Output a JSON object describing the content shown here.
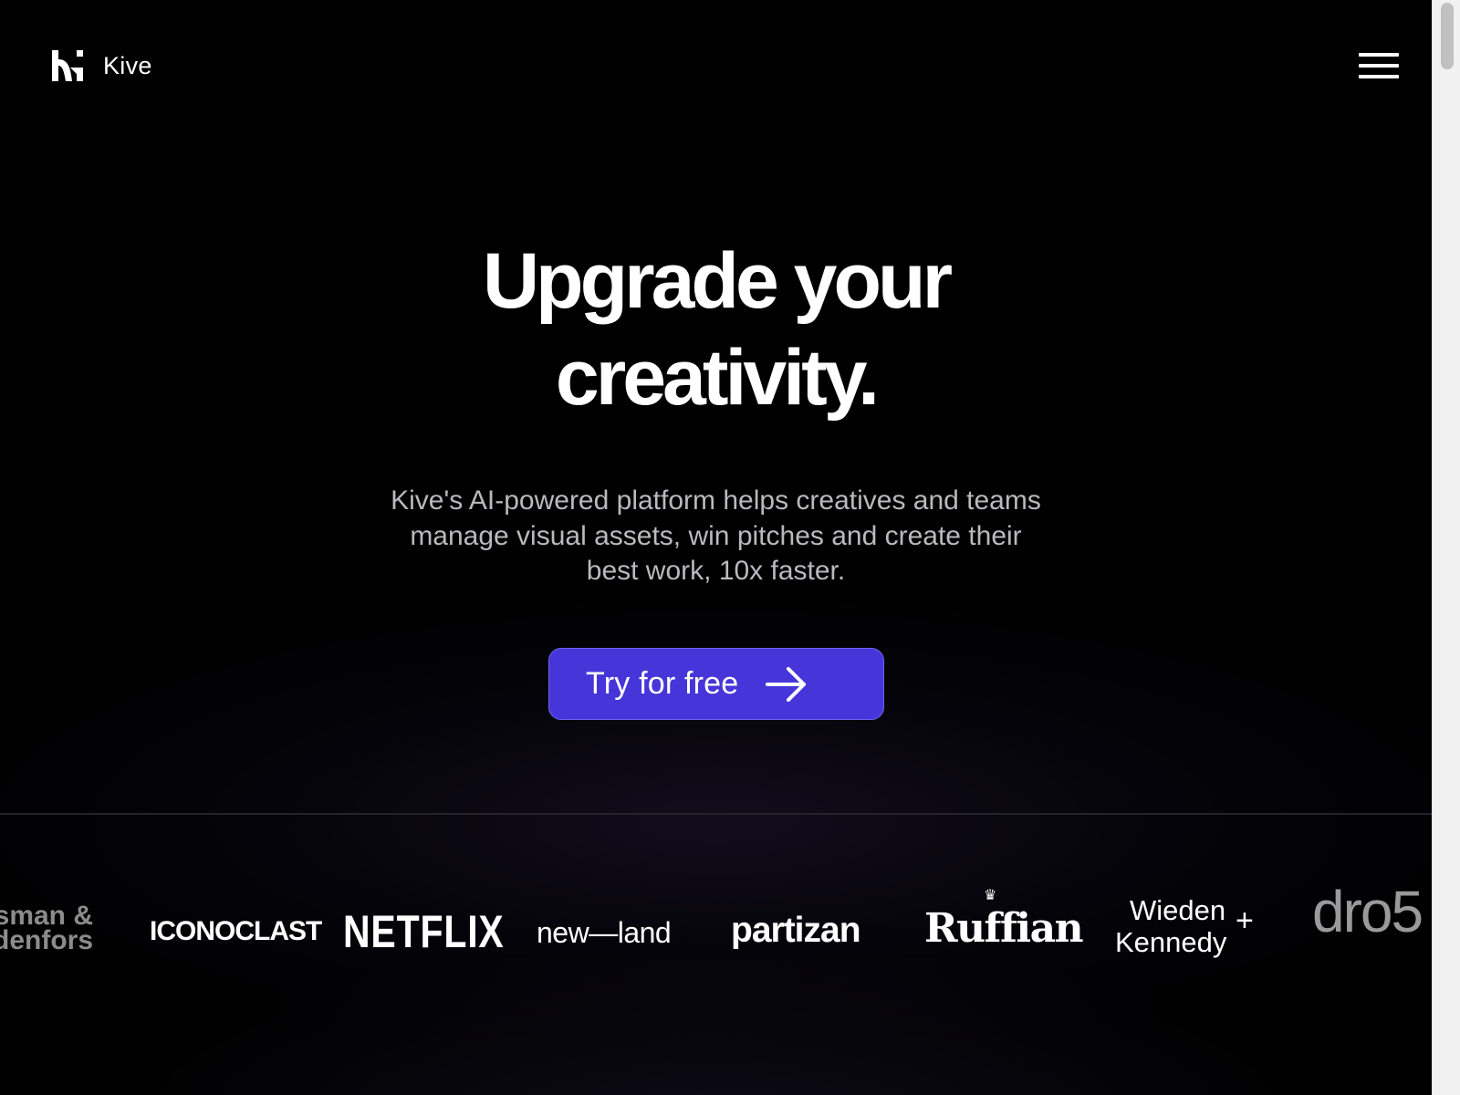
{
  "header": {
    "logo_icon": "kive-logo-icon",
    "logo_text": "Kive",
    "menu_icon": "hamburger-menu-icon"
  },
  "hero": {
    "title_line1": "Upgrade your",
    "title_line2": "creativity.",
    "subtitle": "Kive's AI-powered platform helps creatives and teams manage visual assets, win pitches and create their best work, 10x faster.",
    "cta_label": "Try for free",
    "cta_icon": "arrow-right-icon",
    "cta_color": "#4636d9"
  },
  "logos": {
    "forsman_line1": "sman &",
    "forsman_line2": "denfors",
    "iconoclast": "ICONOCLAST",
    "netflix": "NETFLIX",
    "newland": "new—land",
    "partizan": "partizan",
    "ruffian": "Ruffian",
    "wieden_line1": "Wieden",
    "wieden_line2": "Kennedy",
    "wieden_plus": "+",
    "dro": "dro5"
  },
  "colors": {
    "background": "#000000",
    "subtitle_text": "#b9b9be",
    "divider": "#23232a"
  }
}
